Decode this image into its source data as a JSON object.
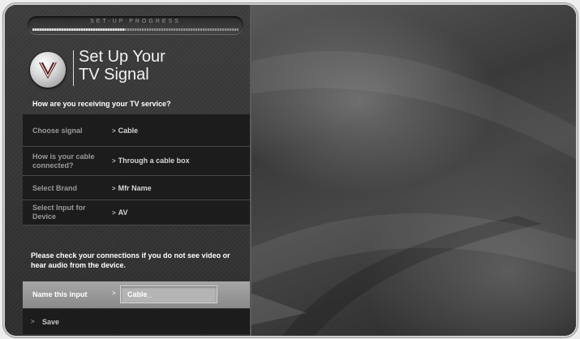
{
  "setup": {
    "progress_label": "SET-UP PROGRESS",
    "progress": 0.45
  },
  "header": {
    "title": "Set Up Your\nTV Signal",
    "logo_icon": "vizio-v-logo-icon"
  },
  "question": "How are you receiving your TV service?",
  "settings": [
    {
      "label": "Choose signal",
      "value": "Cable"
    },
    {
      "label": "How is your cable connected?",
      "value": "Through a cable box"
    },
    {
      "label": "Select Brand",
      "value": "Mfr Name"
    },
    {
      "label": "Select Input for Device",
      "value": "AV"
    }
  ],
  "note": "Please check your connections if you do not see video or hear audio from the device.",
  "name_input": {
    "label": "Name this input",
    "value": "Cable_"
  },
  "save_label": "Save",
  "colors": {
    "panel_bg": "#2e2e2e",
    "row_bg": "#1c1c1c",
    "selected_row": "#9a9a9a"
  }
}
